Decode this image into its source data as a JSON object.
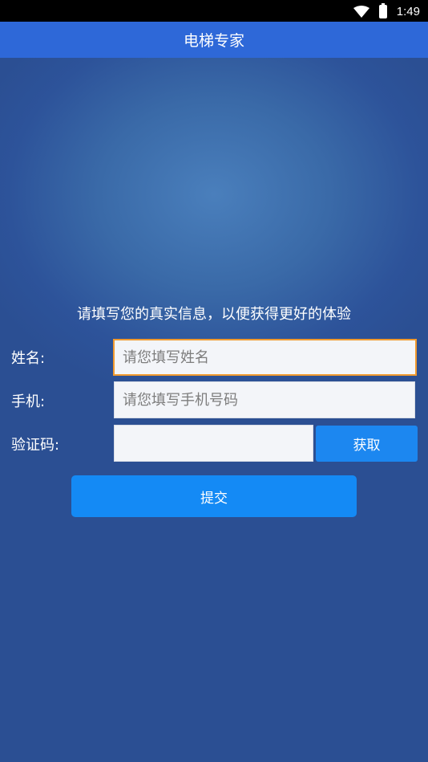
{
  "status_bar": {
    "time": "1:49"
  },
  "app_bar": {
    "title": "电梯专家"
  },
  "form": {
    "notice": "请填写您的真实信息，以便获得更好的体验",
    "name": {
      "label": "姓名:",
      "placeholder": "请您填写姓名",
      "value": ""
    },
    "phone": {
      "label": "手机:",
      "placeholder": "请您填写手机号码",
      "value": ""
    },
    "code": {
      "label": "验证码:",
      "value": "",
      "get_button": "获取"
    },
    "submit_button": "提交"
  },
  "colors": {
    "app_bar": "#2e68d8",
    "primary_button": "#148af5",
    "focus_border": "#f19a2f"
  }
}
